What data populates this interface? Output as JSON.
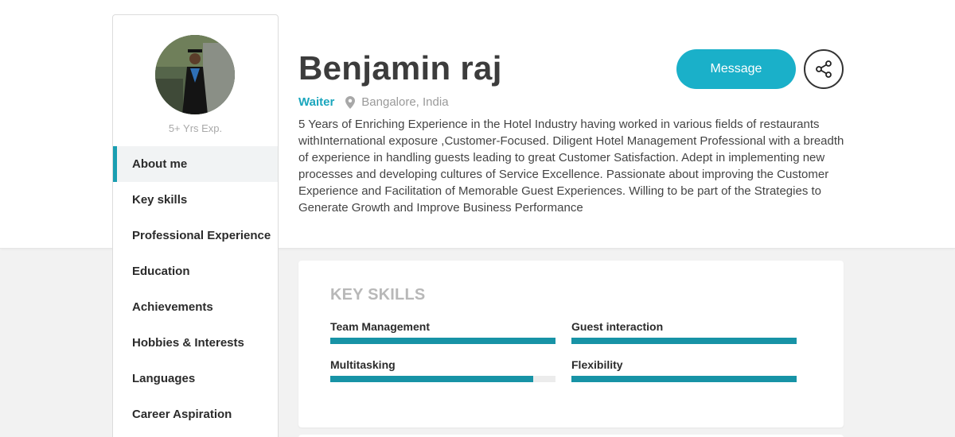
{
  "profile": {
    "name": "Benjamin raj",
    "role": "Waiter",
    "location": "Bangalore, India",
    "experience": "5+ Yrs Exp.",
    "about": "5 Years of Enriching Experience in the Hotel Industry having worked in various fields of restaurants withInternational exposure ,Customer-Focused. Diligent Hotel Management Professional with a breadth of experience in handling guests leading to great Customer Satisfaction. Adept in implementing new processes and developing cultures of Service Excellence. Passionate about improving the Customer Experience and Facilitation of Memorable Guest Experiences. Willing to be part of the Strategies to Generate Growth and Improve Business Performance"
  },
  "actions": {
    "message_label": "Message",
    "share_icon": "share-icon"
  },
  "sidebar": {
    "items": [
      {
        "label": "About me",
        "active": true
      },
      {
        "label": "Key skills"
      },
      {
        "label": "Professional Experience"
      },
      {
        "label": "Education"
      },
      {
        "label": "Achievements"
      },
      {
        "label": "Hobbies & Interests"
      },
      {
        "label": "Languages"
      },
      {
        "label": "Career Aspiration"
      }
    ]
  },
  "key_skills": {
    "title": "KEY SKILLS",
    "skills": [
      {
        "name": "Team Management",
        "level": 1.0
      },
      {
        "name": "Guest interaction",
        "level": 1.0
      },
      {
        "name": "Multitasking",
        "level": 0.9
      },
      {
        "name": "Flexibility",
        "level": 1.0
      }
    ]
  },
  "colors": {
    "accent": "#1ab0c9",
    "bar": "#1793a6",
    "role": "#1aa6bd"
  }
}
